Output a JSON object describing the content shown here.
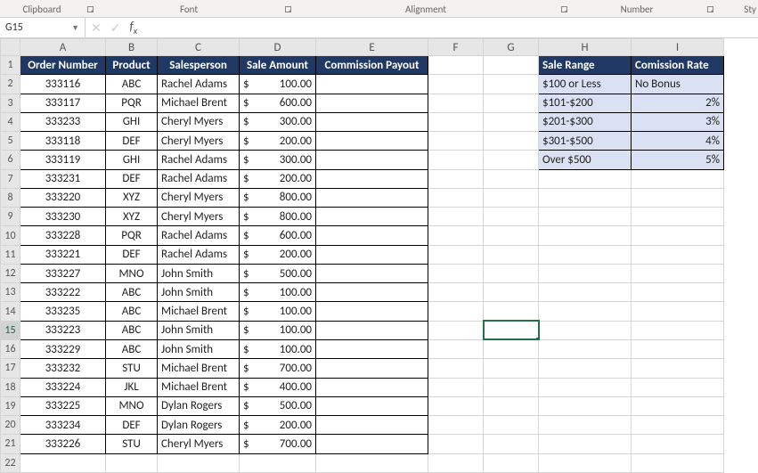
{
  "ribbon_groups": {
    "clipboard": "Clipboard",
    "font": "Font",
    "alignment": "Alignment",
    "number": "Number",
    "styles": "Sty"
  },
  "namebox": "G15",
  "formula": "",
  "columns": [
    "A",
    "B",
    "C",
    "D",
    "E",
    "F",
    "G",
    "H",
    "I"
  ],
  "row_count": 22,
  "headers": {
    "order": "Order Number",
    "product": "Product",
    "sales": "Salesperson",
    "amount": "Sale Amount",
    "comm": "Commission Payout"
  },
  "rows": [
    {
      "order": "333116",
      "product": "ABC",
      "sales": "Rachel Adams",
      "amt": "100.00"
    },
    {
      "order": "333117",
      "product": "PQR",
      "sales": "Michael Brent",
      "amt": "600.00"
    },
    {
      "order": "333233",
      "product": "GHI",
      "sales": "Cheryl Myers",
      "amt": "300.00"
    },
    {
      "order": "333118",
      "product": "DEF",
      "sales": "Cheryl Myers",
      "amt": "200.00"
    },
    {
      "order": "333119",
      "product": "GHI",
      "sales": "Rachel Adams",
      "amt": "300.00"
    },
    {
      "order": "333231",
      "product": "DEF",
      "sales": "Rachel Adams",
      "amt": "200.00"
    },
    {
      "order": "333220",
      "product": "XYZ",
      "sales": "Cheryl Myers",
      "amt": "800.00"
    },
    {
      "order": "333230",
      "product": "XYZ",
      "sales": "Cheryl Myers",
      "amt": "800.00"
    },
    {
      "order": "333228",
      "product": "PQR",
      "sales": "Rachel Adams",
      "amt": "600.00"
    },
    {
      "order": "333221",
      "product": "DEF",
      "sales": "Rachel Adams",
      "amt": "200.00"
    },
    {
      "order": "333227",
      "product": "MNO",
      "sales": "John Smith",
      "amt": "500.00"
    },
    {
      "order": "333222",
      "product": "ABC",
      "sales": "John Smith",
      "amt": "100.00"
    },
    {
      "order": "333235",
      "product": "ABC",
      "sales": "Michael Brent",
      "amt": "100.00"
    },
    {
      "order": "333223",
      "product": "ABC",
      "sales": "John Smith",
      "amt": "100.00"
    },
    {
      "order": "333229",
      "product": "ABC",
      "sales": "John Smith",
      "amt": "100.00"
    },
    {
      "order": "333232",
      "product": "STU",
      "sales": "Michael Brent",
      "amt": "700.00"
    },
    {
      "order": "333224",
      "product": "JKL",
      "sales": "Michael Brent",
      "amt": "400.00"
    },
    {
      "order": "333225",
      "product": "MNO",
      "sales": "Dylan Rogers",
      "amt": "500.00"
    },
    {
      "order": "333234",
      "product": "DEF",
      "sales": "Dylan Rogers",
      "amt": "200.00"
    },
    {
      "order": "333226",
      "product": "STU",
      "sales": "Cheryl Myers",
      "amt": "700.00"
    }
  ],
  "currency_symbol": "$",
  "lookup_headers": {
    "range": "Sale Range",
    "rate": "Comission Rate"
  },
  "lookup": [
    {
      "range": "$100 or Less",
      "rate": "No Bonus"
    },
    {
      "range": "$101-$200",
      "rate": "2%"
    },
    {
      "range": "$201-$300",
      "rate": "3%"
    },
    {
      "range": "$301-$500",
      "rate": "4%"
    },
    {
      "range": "Over $500",
      "rate": "5%"
    }
  ],
  "active_cell": "G15"
}
